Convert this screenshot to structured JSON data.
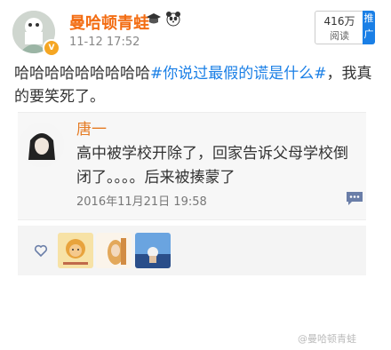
{
  "header": {
    "username": "曼哈顿青蛙",
    "timestamp": "11-12 17:52",
    "views_count": "416万",
    "views_label": "阅读",
    "promote_label": "推广"
  },
  "post": {
    "text_before": "哈哈哈哈哈哈哈哈哈",
    "hashtag": "#你说过最假的谎是什么#",
    "text_after": "，我真的要笑死了。"
  },
  "quoted": {
    "name": "唐一",
    "text": "高中被学校开除了，回家告诉父母学校倒闭了。。。。后来被揍蒙了",
    "date": "2016年11月21日 19:58"
  },
  "watermark": "@曼哈顿青蛙",
  "colors": {
    "username": "#f36d13",
    "hashtag": "#1a7fe6",
    "promote_bg": "#1a7fe6",
    "quote_name": "#e57b24"
  },
  "icons": [
    "verified-v-icon",
    "graduation-cap-icon",
    "panda-icon",
    "comment-icon",
    "heart-icon"
  ]
}
